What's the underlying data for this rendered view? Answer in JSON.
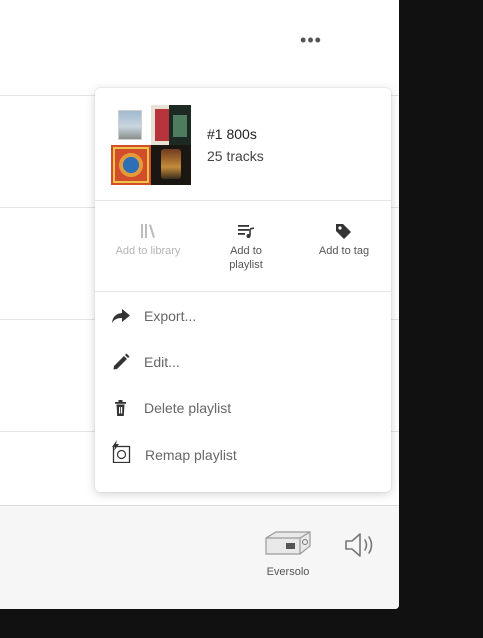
{
  "header": {
    "more_label": "•••"
  },
  "bottom_bar": {
    "device_label": "Eversolo"
  },
  "context_menu": {
    "playlist": {
      "title": "#1 800s",
      "track_count": "25 tracks"
    },
    "actions": [
      {
        "label": "Add to library",
        "icon": "library-icon",
        "enabled": false
      },
      {
        "label": "Add to playlist",
        "icon": "playlist-add-icon",
        "enabled": true
      },
      {
        "label": "Add to tag",
        "icon": "tag-icon",
        "enabled": true
      }
    ],
    "items": [
      {
        "label": "Export...",
        "icon": "share-arrow-icon"
      },
      {
        "label": "Edit...",
        "icon": "pencil-icon"
      },
      {
        "label": "Delete playlist",
        "icon": "trash-icon"
      },
      {
        "label": "Remap playlist",
        "icon": "remap-icon"
      }
    ]
  },
  "colors": {
    "background": "#111111",
    "panel": "#ffffff",
    "menu_text": "#666666",
    "disabled_text": "#b4b4b4"
  }
}
